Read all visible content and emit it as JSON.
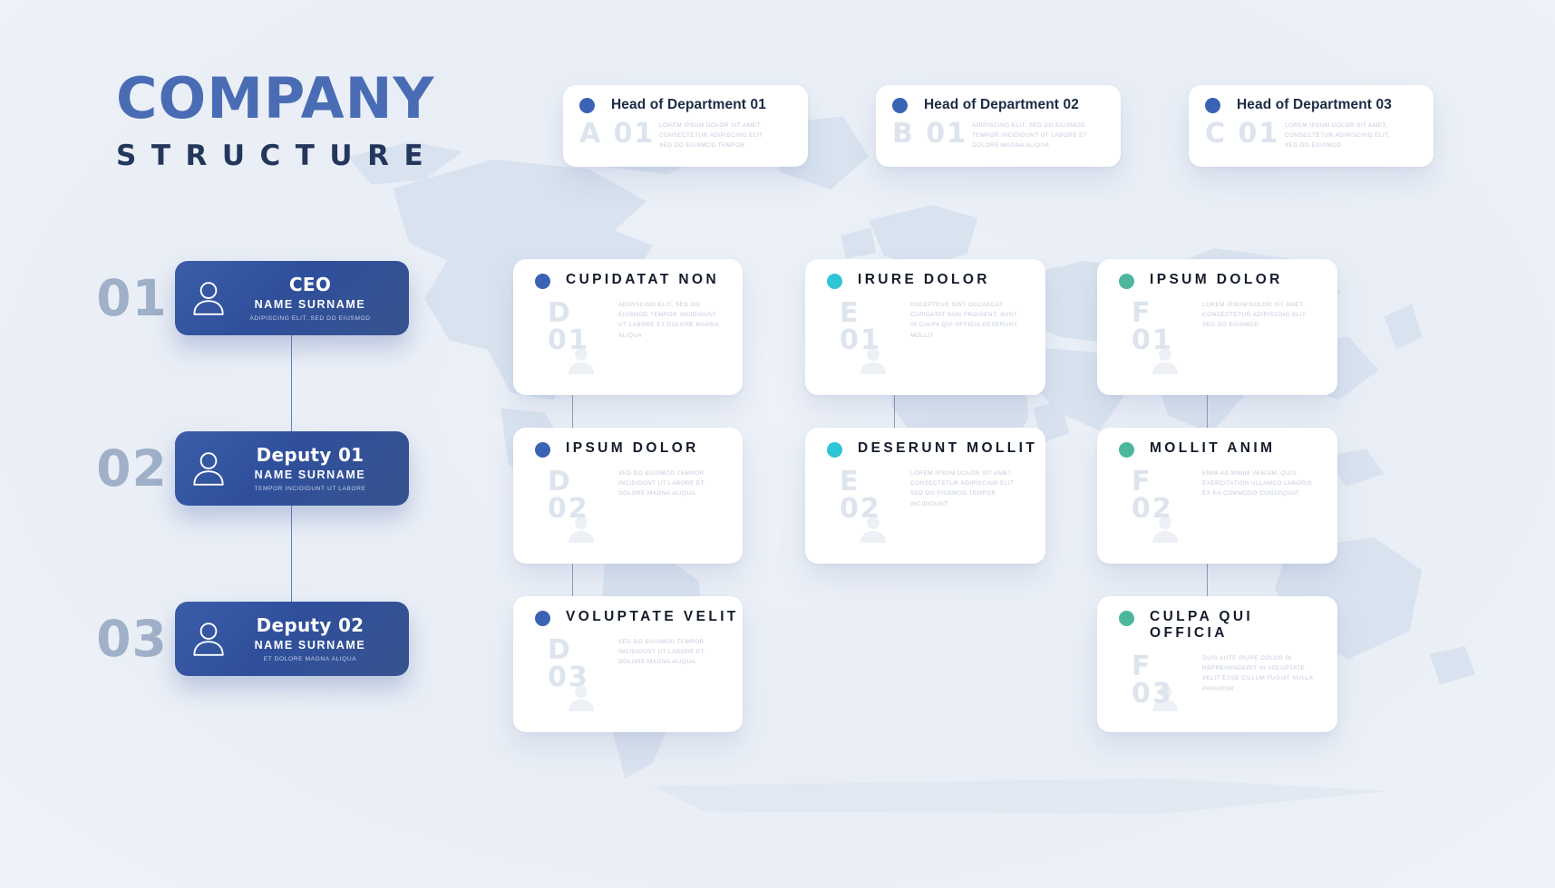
{
  "title": {
    "line1": "COMPANY",
    "line2": "STRUCTURE"
  },
  "colors": {
    "brand_blue": "#4a6cb5",
    "dark_navy": "#23365c",
    "dot_blue": "#3a62b5",
    "dot_cyan": "#2ec5d6",
    "dot_green": "#4cb79e",
    "number_gray": "#9fb0c8",
    "code_gray": "#dde4ee",
    "background": "#eef2f8"
  },
  "executives": [
    {
      "number": "01",
      "title": "CEO",
      "name": "NAME SURNAME",
      "caption": "ADIPISCING ELIT, SED DO EIUSMOD",
      "icon": "person-icon"
    },
    {
      "number": "02",
      "title": "Deputy 01",
      "name": "NAME SURNAME",
      "caption": "TEMPOR INCIDIDUNT UT LABORE",
      "icon": "person-icon"
    },
    {
      "number": "03",
      "title": "Deputy 02",
      "name": "NAME SURNAME",
      "caption": "ET DOLORE MAGNA ALIQUA",
      "icon": "person-icon"
    }
  ],
  "department_heads": [
    {
      "dot": "dot-blue",
      "title": "Head of Department 01",
      "code": "A 01",
      "lorem": "LOREM IPSUM DOLOR SIT AMET CONSECTETUR ADIPISCING ELIT SED DO EIUSMOD TEMPOR"
    },
    {
      "dot": "dot-blue",
      "title": "Head of Department 02",
      "code": "B 01",
      "lorem": "ADIPISCING ELIT, SED DO EIUSMOD TEMPOR INCIDIDUNT UT LABORE ET DOLORE MAGNA ALIQUA"
    },
    {
      "dot": "dot-blue",
      "title": "Head of Department 03",
      "code": "C 01",
      "lorem": "LOREM IPSUM DOLOR SIT AMET, CONSECTETUR ADIPISCING ELIT, SED DO EIUSMOD"
    }
  ],
  "teams": [
    {
      "dot": "dot-blue",
      "title": "CUPIDATAT NON",
      "code": "D 01",
      "lorem": "ADIPISCING ELIT, SED DO EIUSMOD TEMPOR INCIDIDUNT UT LABORE ET DOLORE MAGNA ALIQUA",
      "icon": "person-icon"
    },
    {
      "dot": "dot-cyan",
      "title": "IRURE DOLOR",
      "code": "E 01",
      "lorem": "EXCEPTEUR SINT OCCAECAT CUPIDATAT NON PROIDENT, SUNT IN CULPA QUI OFFICIA DESERUNT MOLLIT",
      "icon": "person-icon"
    },
    {
      "dot": "dot-green",
      "title": "IPSUM DOLOR",
      "code": "F 01",
      "lorem": "LOREM IPSUM DOLOR SIT AMET, CONSECTETUR ADIPISCING ELIT, SED DO EIUSMOD",
      "icon": "person-icon"
    },
    {
      "dot": "dot-blue",
      "title": "IPSUM DOLOR",
      "code": "D 02",
      "lorem": "SED DO EIUSMOD TEMPOR INCIDIDUNT UT LABORE ET DOLORE MAGNA ALIQUA",
      "icon": "person-icon"
    },
    {
      "dot": "dot-cyan",
      "title": "DESERUNT MOLLIT",
      "code": "E 02",
      "lorem": "LOREM IPSUM DOLOR SIT AMET, CONSECTETUR ADIPISCING ELIT SED DO EIUSMOD TEMPOR INCIDIDUNT",
      "icon": "person-icon"
    },
    {
      "dot": "dot-green",
      "title": "MOLLIT ANIM",
      "code": "F 02",
      "lorem": "ENIM AD MINIM VENIAM, QUIS EXERCITATION ULLAMCO LABORIS EX EA COMMODO CONSEQUAT",
      "icon": "person-icon"
    },
    {
      "dot": "dot-blue",
      "title": "VOLUPTATE VELIT",
      "code": "D 03",
      "lorem": "SED DO EIUSMOD TEMPOR INCIDIDUNT UT LABORE ET DOLORE MAGNA ALIQUA",
      "icon": "person-icon"
    },
    {
      "dot": "dot-green",
      "title": "CULPA QUI OFFICIA",
      "code": "F 03",
      "lorem": "DUIS AUTE IRURE DOLOR IN REPREHENDERIT IN VOLUPTATE VELIT ESSE CILLUM FUGIAT NULLA PARIATUR",
      "icon": "person-icon"
    }
  ]
}
